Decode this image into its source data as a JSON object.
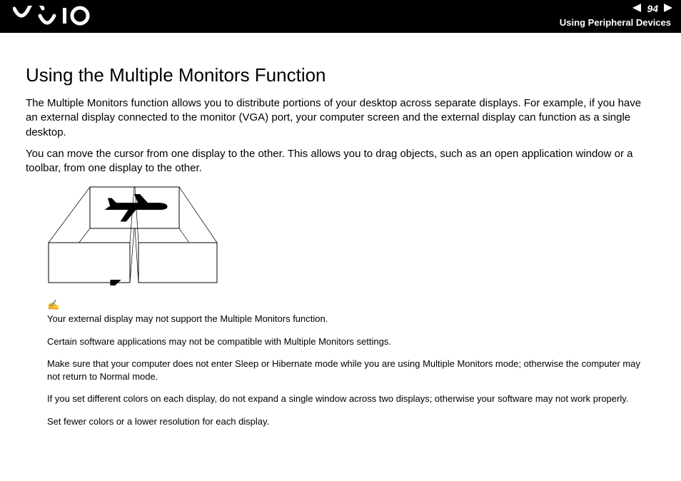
{
  "header": {
    "page_number": "94",
    "section": "Using Peripheral Devices"
  },
  "title": "Using the Multiple Monitors Function",
  "paragraphs": [
    "The Multiple Monitors function allows you to distribute portions of your desktop across separate displays. For example, if you have an external display connected to the monitor (VGA) port, your computer screen and the external display can function as a single desktop.",
    "You can move the cursor from one display to the other. This allows you to drag objects, such as an open application window or a toolbar, from one display to the other."
  ],
  "note_icon": "✍",
  "notes": [
    "Your external display may not support the Multiple Monitors function.",
    "Certain software applications may not be compatible with Multiple Monitors settings.",
    "Make sure that your computer does not enter Sleep or Hibernate mode while you are using Multiple Monitors mode; otherwise the computer may not return to Normal mode.",
    "If you set different colors on each display, do not expand a single window across two displays; otherwise your software may not work properly.",
    "Set fewer colors or a lower resolution for each display."
  ]
}
